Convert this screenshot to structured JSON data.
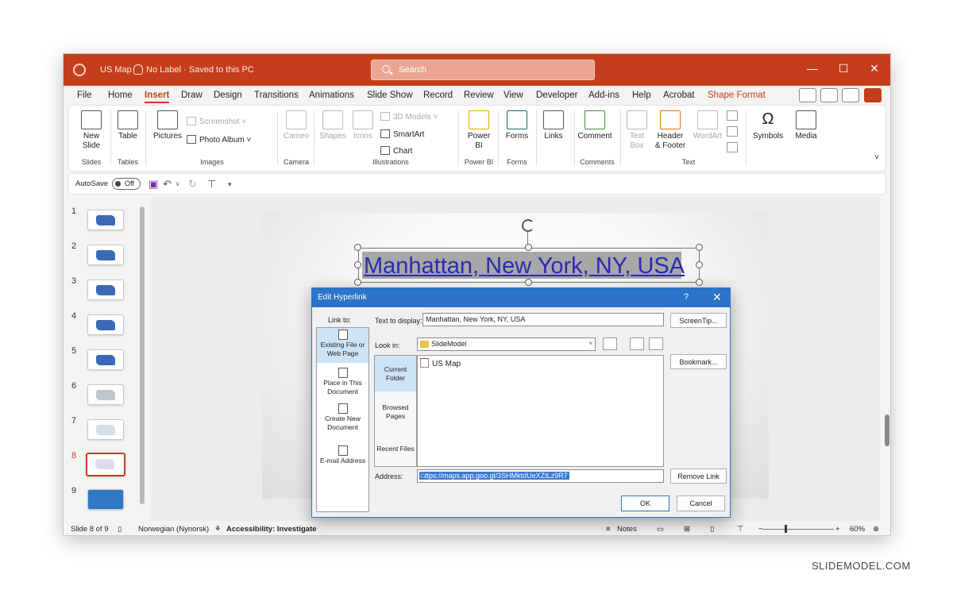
{
  "titlebar": {
    "doc_title": "US Map",
    "label_status": "No Label · Saved to this PC",
    "search_placeholder": "Search"
  },
  "menu": {
    "tabs": [
      "File",
      "Home",
      "Insert",
      "Draw",
      "Design",
      "Transitions",
      "Animations",
      "Slide Show",
      "Record",
      "Review",
      "View",
      "Developer",
      "Add-ins",
      "Help",
      "Acrobat",
      "Shape Format"
    ],
    "active_tab": "Insert"
  },
  "ribbon": {
    "new_slide": "New\nSlide",
    "table": "Table",
    "pictures": "Pictures",
    "screenshot": "Screenshot",
    "photo_album": "Photo Album",
    "cameo": "Cameo",
    "shapes": "Shapes",
    "icons": "Icons",
    "models_3d": "3D Models",
    "smartart": "SmartArt",
    "chart": "Chart",
    "power_bi": "Power\nBI",
    "forms": "Forms",
    "links": "Links",
    "comment": "Comment",
    "text_box": "Text\nBox",
    "header_footer": "Header\n& Footer",
    "wordart": "WordArt",
    "symbols": "Symbols",
    "media": "Media",
    "groups": {
      "slides": "Slides",
      "tables": "Tables",
      "images": "Images",
      "camera": "Camera",
      "illustrations": "Illustrations",
      "power_bi": "Power BI",
      "forms": "Forms",
      "comments": "Comments",
      "text": "Text"
    }
  },
  "qat": {
    "autosave": "AutoSave",
    "toggle": "Off"
  },
  "slides": {
    "numbers": [
      "1",
      "2",
      "3",
      "4",
      "5",
      "6",
      "7",
      "8",
      "9"
    ],
    "active": "8"
  },
  "slide": {
    "title_text": "Manhattan, New York, NY, USA"
  },
  "dialog": {
    "title": "Edit Hyperlink",
    "help": "?",
    "close": "✕",
    "link_to": "Link to:",
    "link_to_items": [
      "Existing File or Web Page",
      "Place in This Document",
      "Create New Document",
      "E-mail Address"
    ],
    "text_to_display_label": "Text to display:",
    "text_to_display_value": "Manhattan, New York, NY, USA",
    "screentip": "ScreenTip...",
    "look_in_label": "Look in:",
    "look_in_value": "SlideModel",
    "bookmark": "Bookmark...",
    "nav_items": [
      "Current Folder",
      "Browsed Pages",
      "Recent Files"
    ],
    "file": "US Map",
    "address_label": "Address:",
    "address_value": "https://maps.app.goo.gl/3SHMktdUeXZtLz9R7",
    "remove_link": "Remove Link",
    "ok": "OK",
    "cancel": "Cancel"
  },
  "status": {
    "slide_info": "Slide 8 of 9",
    "language": "Norwegian (Nynorsk)",
    "accessibility": "Accessibility: Investigate",
    "notes": "Notes",
    "zoom": "60%"
  },
  "watermark": "SLIDEMODEL.COM",
  "colors": {
    "accent": "#c43e1c",
    "dialog_title": "#2b74c8",
    "hyperlink": "#2b2bb2"
  }
}
